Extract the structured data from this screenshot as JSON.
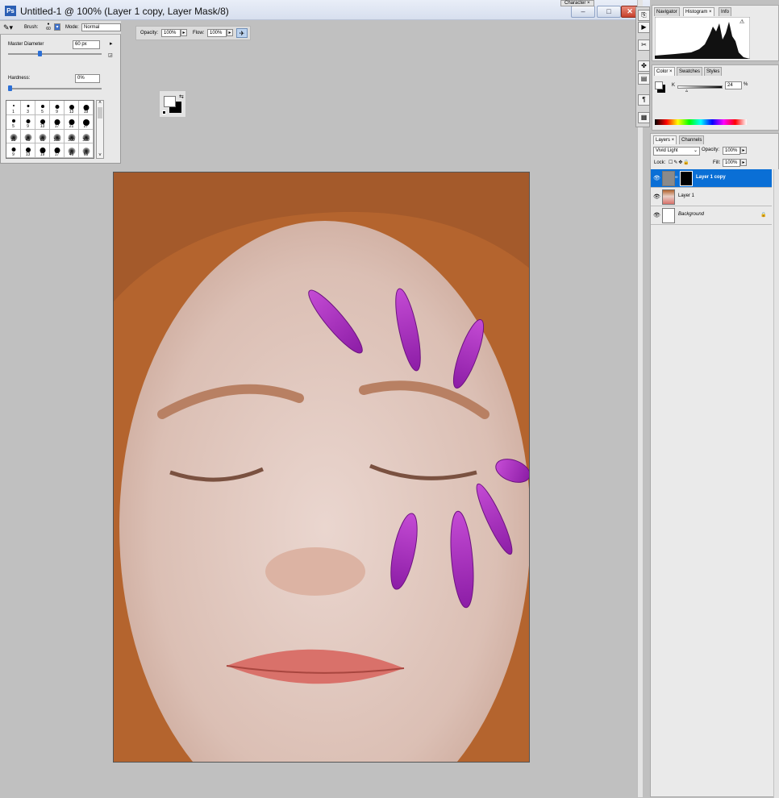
{
  "window": {
    "app_icon": "Ps",
    "title": "Untitled-1 @ 100% (Layer 1 copy, Layer Mask/8)",
    "minimize": "–",
    "maximize": "□",
    "close": "✕"
  },
  "options_bar": {
    "brush_label": "Brush:",
    "brush_size": "60",
    "mode_label": "Mode:",
    "mode_value": "Normal",
    "opacity_label": "Opacity:",
    "opacity_value": "100%",
    "flow_label": "Flow:",
    "flow_value": "100%"
  },
  "brush_panel": {
    "master_diameter_label": "Master Diameter",
    "master_diameter_value": "60 px",
    "master_diameter_level": 0.33,
    "hardness_label": "Hardness:",
    "hardness_value": "0%",
    "hardness_level": 0.0,
    "brush_sizes": [
      "1",
      "3",
      "5",
      "9",
      "13",
      "19",
      "5",
      "9",
      "13",
      "17",
      "21",
      "27",
      "35",
      "45",
      "65",
      "100",
      "200",
      "300",
      "9",
      "13",
      "19",
      "17",
      "45",
      "65"
    ]
  },
  "right_panels": {
    "character_tab": "Character",
    "navigator_tabs": [
      "Navigator",
      "Histogram",
      "Info"
    ],
    "color_tabs": [
      "Color",
      "Swatches",
      "Styles"
    ],
    "color_channel_label": "K",
    "color_channel_value": "24",
    "color_channel_unit": "%",
    "layers_tabs": [
      "Layers",
      "Channels"
    ],
    "blend_mode": "Vivid Light",
    "opacity_label": "Opacity:",
    "opacity_value": "100%",
    "lock_label": "Lock:",
    "fill_label": "Fill:",
    "fill_value": "100%",
    "layers": [
      {
        "name": "Layer 1 copy",
        "selected": true
      },
      {
        "name": "Layer 1",
        "selected": false
      },
      {
        "name": "Background",
        "selected": false,
        "locked": true
      }
    ]
  },
  "colors": {
    "selection_blue": "#0a6fd6",
    "petal_purple": "#a523b8",
    "hair": "#b4642e",
    "lips": "#d9716a"
  }
}
